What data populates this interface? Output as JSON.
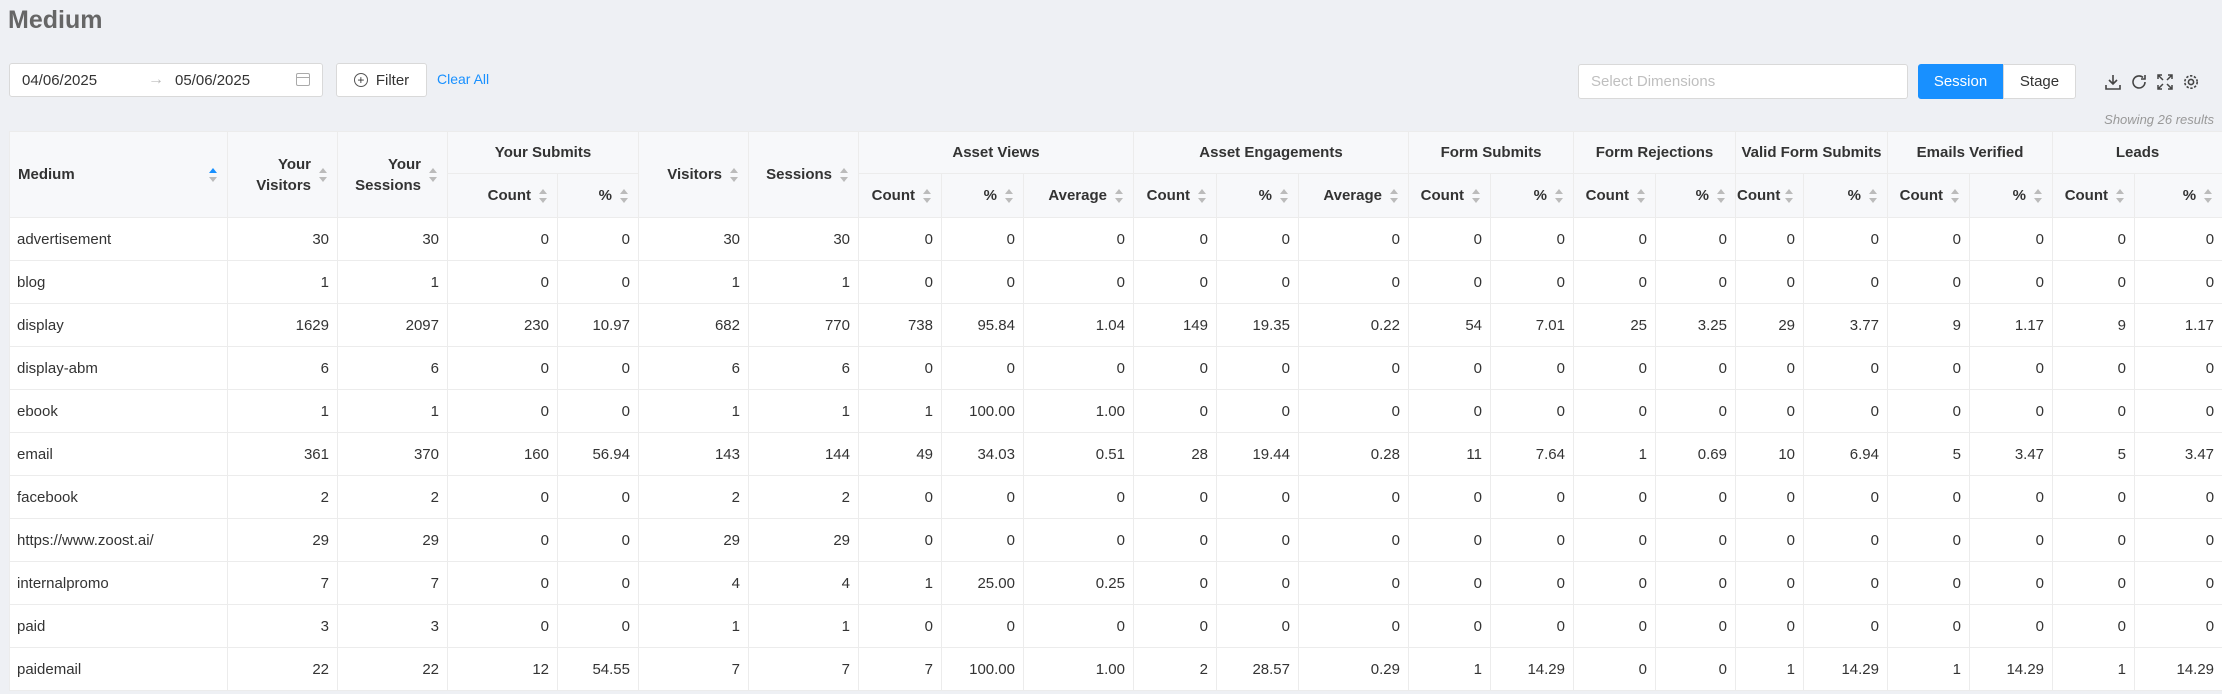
{
  "page": {
    "title": "Medium"
  },
  "filters": {
    "date_start": "04/06/2025",
    "date_end": "05/06/2025",
    "arrow": "→",
    "filter_label": "Filter",
    "clear_label": "Clear All",
    "dimensions_placeholder": "Select Dimensions",
    "session_label": "Session",
    "stage_label": "Stage"
  },
  "toolbar": {
    "icons": [
      "download-icon",
      "refresh-icon",
      "fullscreen-icon",
      "settings-icon"
    ]
  },
  "results": {
    "text": "Showing 26 results"
  },
  "table": {
    "col_medium": "Medium",
    "col_your_visitors": "Your Visitors",
    "col_your_sessions": "Your Sessions",
    "group_your_submits": "Your Submits",
    "col_visitors": "Visitors",
    "col_sessions": "Sessions",
    "group_asset_views": "Asset Views",
    "group_asset_engagements": "Asset Engagements",
    "group_form_submits": "Form Submits",
    "group_form_rejections": "Form Rejections",
    "group_valid_form_submits": "Valid Form Submits",
    "group_emails_verified": "Emails Verified",
    "group_leads": "Leads",
    "sub_count": "Count",
    "sub_pct": "%",
    "sub_avg": "Average",
    "rows": [
      [
        "advertisement",
        "30",
        "30",
        "0",
        "0",
        "30",
        "30",
        "0",
        "0",
        "0",
        "0",
        "0",
        "0",
        "0",
        "0",
        "0",
        "0",
        "0",
        "0",
        "0",
        "0",
        "0",
        "0"
      ],
      [
        "blog",
        "1",
        "1",
        "0",
        "0",
        "1",
        "1",
        "0",
        "0",
        "0",
        "0",
        "0",
        "0",
        "0",
        "0",
        "0",
        "0",
        "0",
        "0",
        "0",
        "0",
        "0",
        "0"
      ],
      [
        "display",
        "1629",
        "2097",
        "230",
        "10.97",
        "682",
        "770",
        "738",
        "95.84",
        "1.04",
        "149",
        "19.35",
        "0.22",
        "54",
        "7.01",
        "25",
        "3.25",
        "29",
        "3.77",
        "9",
        "1.17",
        "9",
        "1.17"
      ],
      [
        "display-abm",
        "6",
        "6",
        "0",
        "0",
        "6",
        "6",
        "0",
        "0",
        "0",
        "0",
        "0",
        "0",
        "0",
        "0",
        "0",
        "0",
        "0",
        "0",
        "0",
        "0",
        "0",
        "0"
      ],
      [
        "ebook",
        "1",
        "1",
        "0",
        "0",
        "1",
        "1",
        "1",
        "100.00",
        "1.00",
        "0",
        "0",
        "0",
        "0",
        "0",
        "0",
        "0",
        "0",
        "0",
        "0",
        "0",
        "0",
        "0"
      ],
      [
        "email",
        "361",
        "370",
        "160",
        "56.94",
        "143",
        "144",
        "49",
        "34.03",
        "0.51",
        "28",
        "19.44",
        "0.28",
        "11",
        "7.64",
        "1",
        "0.69",
        "10",
        "6.94",
        "5",
        "3.47",
        "5",
        "3.47"
      ],
      [
        "facebook",
        "2",
        "2",
        "0",
        "0",
        "2",
        "2",
        "0",
        "0",
        "0",
        "0",
        "0",
        "0",
        "0",
        "0",
        "0",
        "0",
        "0",
        "0",
        "0",
        "0",
        "0",
        "0"
      ],
      [
        "https://www.zoost.ai/",
        "29",
        "29",
        "0",
        "0",
        "29",
        "29",
        "0",
        "0",
        "0",
        "0",
        "0",
        "0",
        "0",
        "0",
        "0",
        "0",
        "0",
        "0",
        "0",
        "0",
        "0",
        "0"
      ],
      [
        "internalpromo",
        "7",
        "7",
        "0",
        "0",
        "4",
        "4",
        "1",
        "25.00",
        "0.25",
        "0",
        "0",
        "0",
        "0",
        "0",
        "0",
        "0",
        "0",
        "0",
        "0",
        "0",
        "0",
        "0"
      ],
      [
        "paid",
        "3",
        "3",
        "0",
        "0",
        "1",
        "1",
        "0",
        "0",
        "0",
        "0",
        "0",
        "0",
        "0",
        "0",
        "0",
        "0",
        "0",
        "0",
        "0",
        "0",
        "0",
        "0"
      ],
      [
        "paidemail",
        "22",
        "22",
        "12",
        "54.55",
        "7",
        "7",
        "7",
        "100.00",
        "1.00",
        "2",
        "28.57",
        "0.29",
        "1",
        "14.29",
        "0",
        "0",
        "1",
        "14.29",
        "1",
        "14.29",
        "1",
        "14.29"
      ]
    ]
  }
}
